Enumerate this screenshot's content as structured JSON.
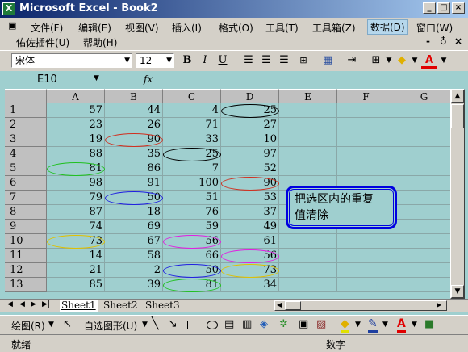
{
  "window": {
    "title": "Microsoft Excel - Book2",
    "buttons": [
      "_",
      "□",
      "×"
    ]
  },
  "menu": {
    "items": [
      "文件(F)",
      "编辑(E)",
      "视图(V)",
      "插入(I)",
      "格式(O)",
      "工具(T)",
      "工具箱(Z)",
      "数据(D)",
      "窗口(W)"
    ],
    "items2": [
      "佑佐插件(U)",
      "帮助(H)"
    ],
    "doc_buttons": [
      "-",
      "♁",
      "×"
    ]
  },
  "format_toolbar": {
    "font": "宋体",
    "size": "12",
    "bold": "B",
    "italic": "I",
    "underline": "U",
    "font_color_label": "A"
  },
  "formula_bar": {
    "name_box": "E10",
    "fx": "fx",
    "formula": ""
  },
  "grid": {
    "columns": [
      "A",
      "B",
      "C",
      "D",
      "E",
      "F",
      "G"
    ],
    "rows": [
      "1",
      "2",
      "3",
      "4",
      "5",
      "6",
      "7",
      "8",
      "9",
      "10",
      "11",
      "12",
      "13"
    ],
    "cells": [
      [
        "57",
        "44",
        "4",
        "25"
      ],
      [
        "23",
        "26",
        "71",
        "27"
      ],
      [
        "19",
        "90",
        "33",
        "10"
      ],
      [
        "88",
        "35",
        "25",
        "97"
      ],
      [
        "81",
        "86",
        "7",
        "52"
      ],
      [
        "98",
        "91",
        "100",
        "90"
      ],
      [
        "79",
        "50",
        "51",
        "53"
      ],
      [
        "87",
        "18",
        "76",
        "37"
      ],
      [
        "74",
        "69",
        "59",
        "49"
      ],
      [
        "73",
        "67",
        "56",
        "61"
      ],
      [
        "14",
        "58",
        "66",
        "56"
      ],
      [
        "21",
        "2",
        "50",
        "73"
      ],
      [
        "85",
        "39",
        "81",
        "34"
      ]
    ]
  },
  "callout": {
    "line1": "把选区内的重复",
    "line2": "值清除"
  },
  "sheet_tabs": [
    "Sheet1",
    "Sheet2",
    "Sheet3"
  ],
  "drawing_toolbar": {
    "draw_label": "绘图(R)",
    "autoshapes_label": "自选图形(U)"
  },
  "status": {
    "left": "就绪",
    "right": "数字"
  },
  "colors": {
    "background": "#9fcfcf",
    "title_start": "#0a246a",
    "callout_border": "#0000e0"
  }
}
